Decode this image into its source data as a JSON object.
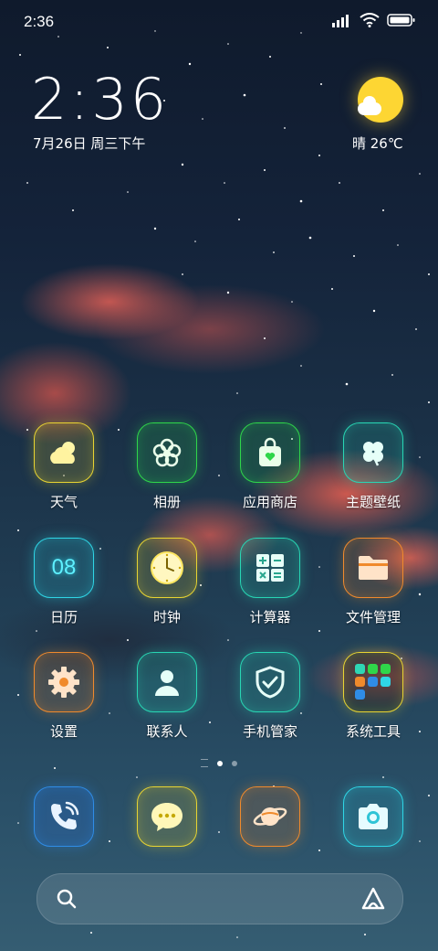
{
  "status_bar": {
    "time": "2:36"
  },
  "clock": {
    "time": "2:36",
    "date": "7月26日 周三下午"
  },
  "weather": {
    "text": "晴 26℃",
    "icon": "sun-cloud-icon"
  },
  "apps": [
    {
      "label": "天气",
      "icon": "weather-cloud-icon",
      "color": "#e8d432"
    },
    {
      "label": "相册",
      "icon": "gallery-flower-icon",
      "color": "#2fd64a"
    },
    {
      "label": "应用商店",
      "icon": "store-bag-icon",
      "color": "#2fd64a"
    },
    {
      "label": "主题壁纸",
      "icon": "clover-icon",
      "color": "#28d6b4"
    },
    {
      "label": "日历",
      "icon": "calendar-icon",
      "value": "08",
      "color": "#2fd6e6"
    },
    {
      "label": "时钟",
      "icon": "clock-icon",
      "color": "#e8d432"
    },
    {
      "label": "计算器",
      "icon": "calculator-icon",
      "color": "#28d6b4"
    },
    {
      "label": "文件管理",
      "icon": "folder-icon",
      "color": "#f08a2c"
    },
    {
      "label": "设置",
      "icon": "gear-icon",
      "color": "#f08a2c"
    },
    {
      "label": "联系人",
      "icon": "contact-person-icon",
      "color": "#28d6b4"
    },
    {
      "label": "手机管家",
      "icon": "security-shield-icon",
      "color": "#28d6b4"
    },
    {
      "label": "系统工具",
      "icon": "folder-grid-icon",
      "color": "#e8d432"
    }
  ],
  "dock": [
    {
      "name": "phone",
      "icon": "phone-icon",
      "color": "#2f8ce6"
    },
    {
      "name": "messages",
      "icon": "message-bubble-icon",
      "color": "#e8d432"
    },
    {
      "name": "browser",
      "icon": "planet-icon",
      "color": "#f08a2c"
    },
    {
      "name": "camera",
      "icon": "camera-icon",
      "color": "#2fd6e6"
    }
  ],
  "page_indicator": {
    "pages": 2,
    "current": 1
  }
}
